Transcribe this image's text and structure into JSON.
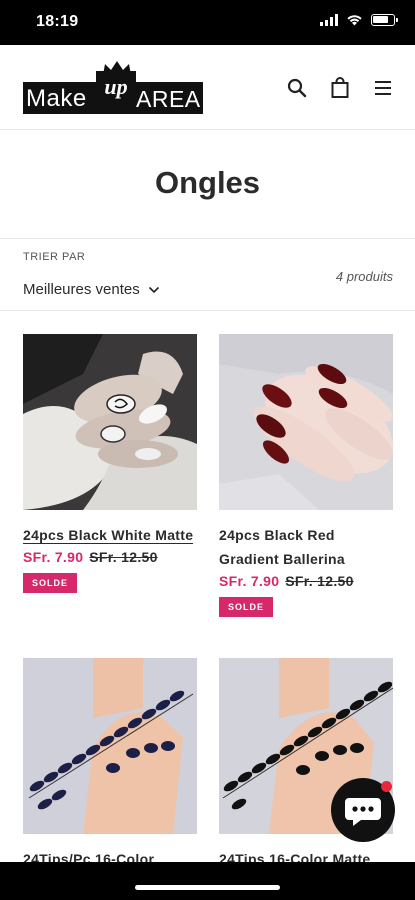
{
  "status": {
    "time": "18:19"
  },
  "header": {
    "logo": {
      "make": "Make",
      "up": "up",
      "area": "AREA"
    },
    "icons": [
      "search-icon",
      "bag-icon",
      "menu-icon"
    ]
  },
  "page": {
    "title": "Ongles"
  },
  "sort": {
    "label": "TRIER PAR",
    "value": "Meilleures ventes",
    "count": "4 produits"
  },
  "products": [
    {
      "title": "24pcs Black White Matte",
      "price": "SFr. 7.90",
      "old_price": "SFr. 12.50",
      "badge": "SOLDE"
    },
    {
      "title": "24pcs Black Red Gradient Ballerina",
      "price": "SFr. 7.90",
      "old_price": "SFr. 12.50",
      "badge": "SOLDE"
    },
    {
      "title": "24Tips/Pc 16-Color",
      "price": "",
      "old_price": "",
      "badge": ""
    },
    {
      "title": "24Tips 16-Color Matte",
      "price": "",
      "old_price": "",
      "badge": ""
    }
  ],
  "colors": {
    "sale": "#d6286a",
    "chat_notification": "#e8273d"
  }
}
